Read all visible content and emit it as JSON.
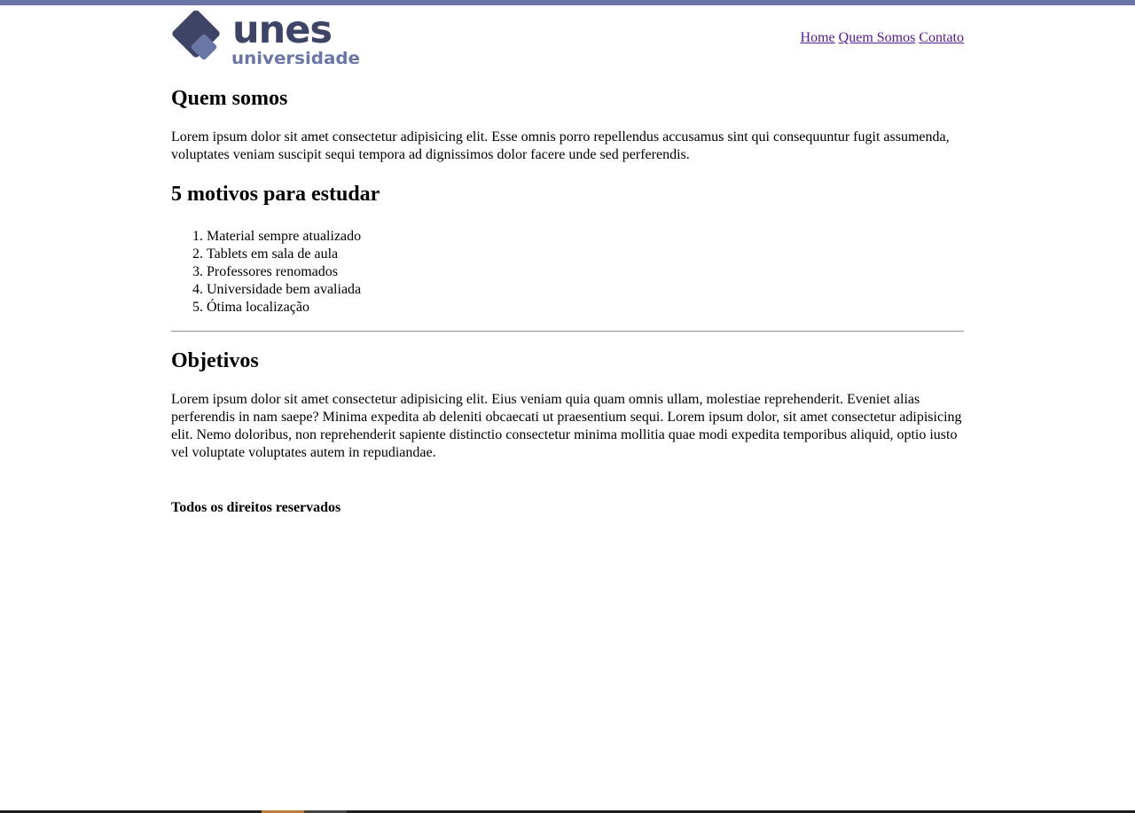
{
  "logo": {
    "line1": "unes",
    "line2": "universidade",
    "icon": "diamond-logo-icon",
    "color_dark": "#3d4466",
    "color_light": "#6a76a6"
  },
  "nav": {
    "items": [
      {
        "label": "Home"
      },
      {
        "label": "Quem Somos"
      },
      {
        "label": "Contato"
      }
    ]
  },
  "quem_somos": {
    "title": "Quem somos",
    "text": "Lorem ipsum dolor sit amet consectetur adipisicing elit. Esse omnis porro repellendus accusamus sint qui consequuntur fugit assumenda, voluptates veniam suscipit sequi tempora ad dignissimos dolor facere unde sed perferendis."
  },
  "motivos": {
    "title": "5 motivos para estudar",
    "items": [
      "Material sempre atualizado",
      "Tablets em sala de aula",
      "Professores renomados",
      "Universidade bem avaliada",
      "Ótima localização"
    ]
  },
  "objetivos": {
    "title": "Objetivos",
    "text": "Lorem ipsum dolor sit amet consectetur adipisicing elit. Eius veniam quia quam omnis ullam, molestiae reprehenderit. Eveniet alias perferendis in nam saepe? Minima expedita ab deleniti obcaecati ut praesentium sequi. Lorem ipsum dolor, sit amet consectetur adipisicing elit. Nemo doloribus, non reprehenderit sapiente distinctio consectetur minima mollitia quae modi expedita temporibus aliquid, optio iusto vel voluptate voluptates autem in repudiandae."
  },
  "footer": {
    "text": "Todos os direitos reservados"
  },
  "colors": {
    "top_bar": "#6a76a6",
    "link": "#551a8b"
  }
}
